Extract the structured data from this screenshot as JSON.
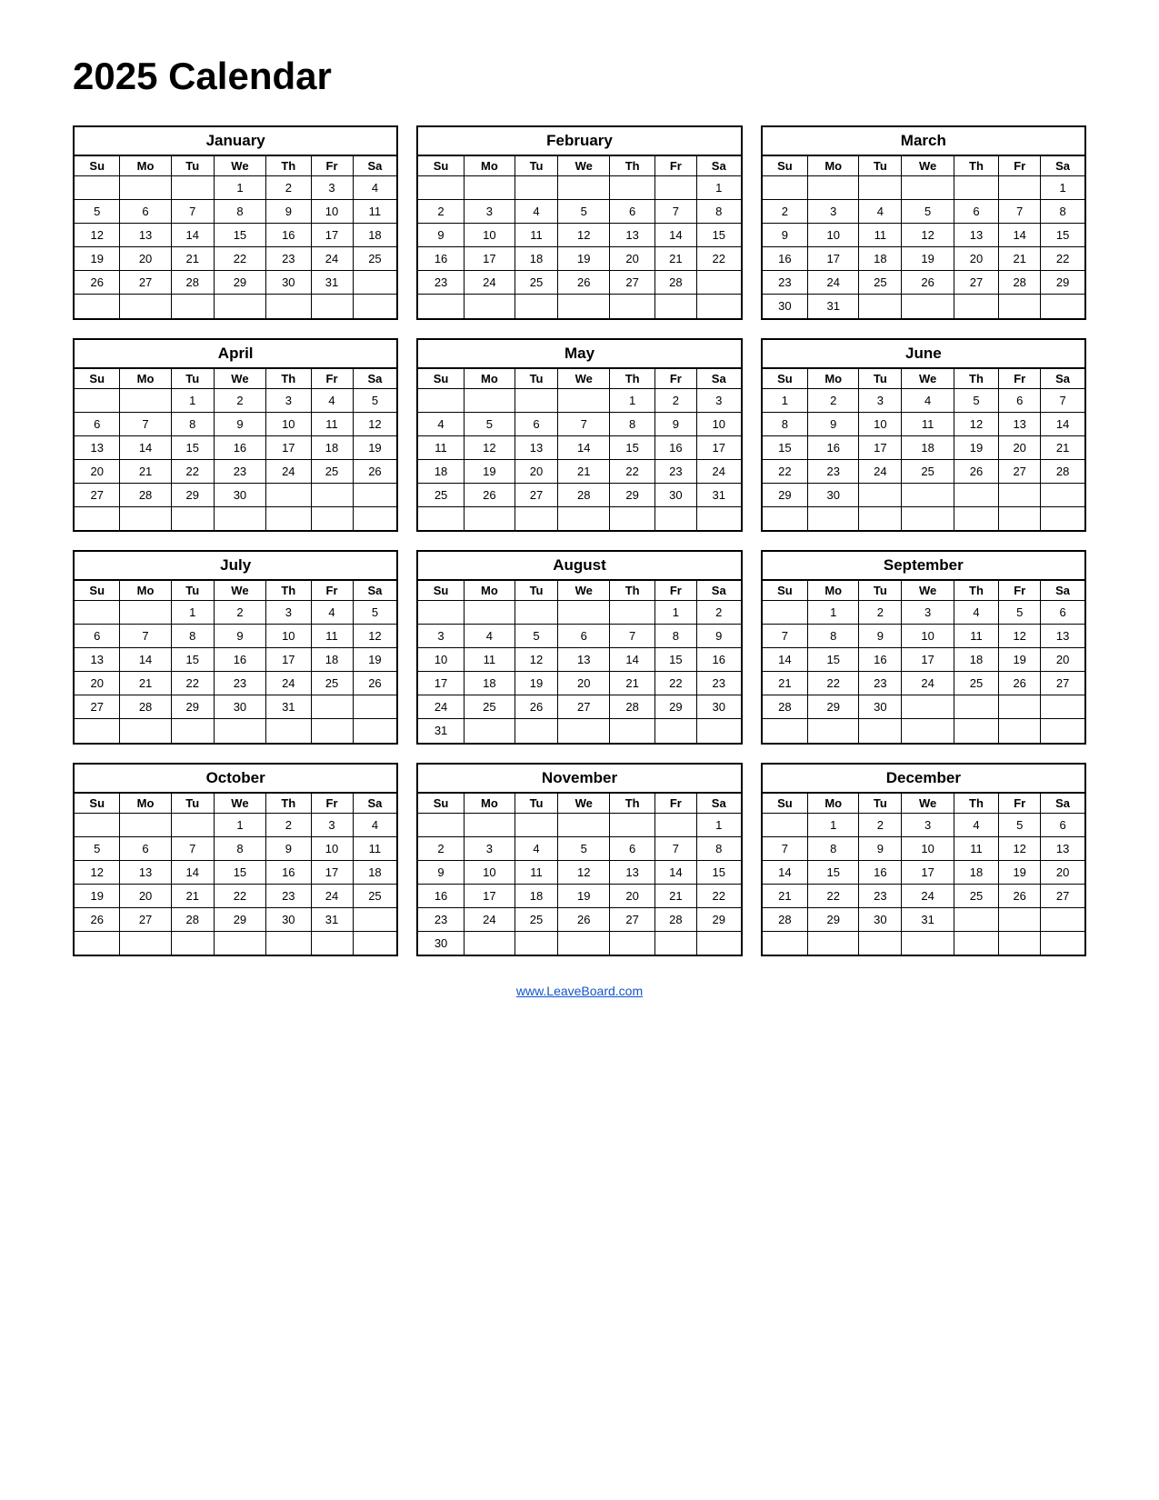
{
  "title": "2025 Calendar",
  "footer_link": "www.LeaveBoard.com",
  "months": [
    {
      "name": "January",
      "days": [
        "Su",
        "Mo",
        "Tu",
        "We",
        "Th",
        "Fr",
        "Sa"
      ],
      "weeks": [
        [
          "",
          "",
          "",
          "1",
          "2",
          "3",
          "4"
        ],
        [
          "5",
          "6",
          "7",
          "8",
          "9",
          "10",
          "11"
        ],
        [
          "12",
          "13",
          "14",
          "15",
          "16",
          "17",
          "18"
        ],
        [
          "19",
          "20",
          "21",
          "22",
          "23",
          "24",
          "25"
        ],
        [
          "26",
          "27",
          "28",
          "29",
          "30",
          "31",
          ""
        ],
        [
          "",
          "",
          "",
          "",
          "",
          "",
          ""
        ]
      ]
    },
    {
      "name": "February",
      "days": [
        "Su",
        "Mo",
        "Tu",
        "We",
        "Th",
        "Fr",
        "Sa"
      ],
      "weeks": [
        [
          "",
          "",
          "",
          "",
          "",
          "",
          "1"
        ],
        [
          "2",
          "3",
          "4",
          "5",
          "6",
          "7",
          "8"
        ],
        [
          "9",
          "10",
          "11",
          "12",
          "13",
          "14",
          "15"
        ],
        [
          "16",
          "17",
          "18",
          "19",
          "20",
          "21",
          "22"
        ],
        [
          "23",
          "24",
          "25",
          "26",
          "27",
          "28",
          ""
        ],
        [
          "",
          "",
          "",
          "",
          "",
          "",
          ""
        ]
      ]
    },
    {
      "name": "March",
      "days": [
        "Su",
        "Mo",
        "Tu",
        "We",
        "Th",
        "Fr",
        "Sa"
      ],
      "weeks": [
        [
          "",
          "",
          "",
          "",
          "",
          "",
          "1"
        ],
        [
          "2",
          "3",
          "4",
          "5",
          "6",
          "7",
          "8"
        ],
        [
          "9",
          "10",
          "11",
          "12",
          "13",
          "14",
          "15"
        ],
        [
          "16",
          "17",
          "18",
          "19",
          "20",
          "21",
          "22"
        ],
        [
          "23",
          "24",
          "25",
          "26",
          "27",
          "28",
          "29"
        ],
        [
          "30",
          "31",
          "",
          "",
          "",
          "",
          ""
        ]
      ]
    },
    {
      "name": "April",
      "days": [
        "Su",
        "Mo",
        "Tu",
        "We",
        "Th",
        "Fr",
        "Sa"
      ],
      "weeks": [
        [
          "",
          "",
          "1",
          "2",
          "3",
          "4",
          "5"
        ],
        [
          "6",
          "7",
          "8",
          "9",
          "10",
          "11",
          "12"
        ],
        [
          "13",
          "14",
          "15",
          "16",
          "17",
          "18",
          "19"
        ],
        [
          "20",
          "21",
          "22",
          "23",
          "24",
          "25",
          "26"
        ],
        [
          "27",
          "28",
          "29",
          "30",
          "",
          "",
          ""
        ],
        [
          "",
          "",
          "",
          "",
          "",
          "",
          ""
        ]
      ]
    },
    {
      "name": "May",
      "days": [
        "Su",
        "Mo",
        "Tu",
        "We",
        "Th",
        "Fr",
        "Sa"
      ],
      "weeks": [
        [
          "",
          "",
          "",
          "",
          "1",
          "2",
          "3"
        ],
        [
          "4",
          "5",
          "6",
          "7",
          "8",
          "9",
          "10"
        ],
        [
          "11",
          "12",
          "13",
          "14",
          "15",
          "16",
          "17"
        ],
        [
          "18",
          "19",
          "20",
          "21",
          "22",
          "23",
          "24"
        ],
        [
          "25",
          "26",
          "27",
          "28",
          "29",
          "30",
          "31"
        ],
        [
          "",
          "",
          "",
          "",
          "",
          "",
          ""
        ]
      ]
    },
    {
      "name": "June",
      "days": [
        "Su",
        "Mo",
        "Tu",
        "We",
        "Th",
        "Fr",
        "Sa"
      ],
      "weeks": [
        [
          "1",
          "2",
          "3",
          "4",
          "5",
          "6",
          "7"
        ],
        [
          "8",
          "9",
          "10",
          "11",
          "12",
          "13",
          "14"
        ],
        [
          "15",
          "16",
          "17",
          "18",
          "19",
          "20",
          "21"
        ],
        [
          "22",
          "23",
          "24",
          "25",
          "26",
          "27",
          "28"
        ],
        [
          "29",
          "30",
          "",
          "",
          "",
          "",
          ""
        ],
        [
          "",
          "",
          "",
          "",
          "",
          "",
          ""
        ]
      ]
    },
    {
      "name": "July",
      "days": [
        "Su",
        "Mo",
        "Tu",
        "We",
        "Th",
        "Fr",
        "Sa"
      ],
      "weeks": [
        [
          "",
          "",
          "1",
          "2",
          "3",
          "4",
          "5"
        ],
        [
          "6",
          "7",
          "8",
          "9",
          "10",
          "11",
          "12"
        ],
        [
          "13",
          "14",
          "15",
          "16",
          "17",
          "18",
          "19"
        ],
        [
          "20",
          "21",
          "22",
          "23",
          "24",
          "25",
          "26"
        ],
        [
          "27",
          "28",
          "29",
          "30",
          "31",
          "",
          ""
        ],
        [
          "",
          "",
          "",
          "",
          "",
          "",
          ""
        ]
      ]
    },
    {
      "name": "August",
      "days": [
        "Su",
        "Mo",
        "Tu",
        "We",
        "Th",
        "Fr",
        "Sa"
      ],
      "weeks": [
        [
          "",
          "",
          "",
          "",
          "",
          "1",
          "2"
        ],
        [
          "3",
          "4",
          "5",
          "6",
          "7",
          "8",
          "9"
        ],
        [
          "10",
          "11",
          "12",
          "13",
          "14",
          "15",
          "16"
        ],
        [
          "17",
          "18",
          "19",
          "20",
          "21",
          "22",
          "23"
        ],
        [
          "24",
          "25",
          "26",
          "27",
          "28",
          "29",
          "30"
        ],
        [
          "31",
          "",
          "",
          "",
          "",
          "",
          ""
        ]
      ]
    },
    {
      "name": "September",
      "days": [
        "Su",
        "Mo",
        "Tu",
        "We",
        "Th",
        "Fr",
        "Sa"
      ],
      "weeks": [
        [
          "",
          "1",
          "2",
          "3",
          "4",
          "5",
          "6"
        ],
        [
          "7",
          "8",
          "9",
          "10",
          "11",
          "12",
          "13"
        ],
        [
          "14",
          "15",
          "16",
          "17",
          "18",
          "19",
          "20"
        ],
        [
          "21",
          "22",
          "23",
          "24",
          "25",
          "26",
          "27"
        ],
        [
          "28",
          "29",
          "30",
          "",
          "",
          "",
          ""
        ],
        [
          "",
          "",
          "",
          "",
          "",
          "",
          ""
        ]
      ]
    },
    {
      "name": "October",
      "days": [
        "Su",
        "Mo",
        "Tu",
        "We",
        "Th",
        "Fr",
        "Sa"
      ],
      "weeks": [
        [
          "",
          "",
          "",
          "1",
          "2",
          "3",
          "4"
        ],
        [
          "5",
          "6",
          "7",
          "8",
          "9",
          "10",
          "11"
        ],
        [
          "12",
          "13",
          "14",
          "15",
          "16",
          "17",
          "18"
        ],
        [
          "19",
          "20",
          "21",
          "22",
          "23",
          "24",
          "25"
        ],
        [
          "26",
          "27",
          "28",
          "29",
          "30",
          "31",
          ""
        ],
        [
          "",
          "",
          "",
          "",
          "",
          "",
          ""
        ]
      ]
    },
    {
      "name": "November",
      "days": [
        "Su",
        "Mo",
        "Tu",
        "We",
        "Th",
        "Fr",
        "Sa"
      ],
      "weeks": [
        [
          "",
          "",
          "",
          "",
          "",
          "",
          "1"
        ],
        [
          "2",
          "3",
          "4",
          "5",
          "6",
          "7",
          "8"
        ],
        [
          "9",
          "10",
          "11",
          "12",
          "13",
          "14",
          "15"
        ],
        [
          "16",
          "17",
          "18",
          "19",
          "20",
          "21",
          "22"
        ],
        [
          "23",
          "24",
          "25",
          "26",
          "27",
          "28",
          "29"
        ],
        [
          "30",
          "",
          "",
          "",
          "",
          "",
          ""
        ]
      ]
    },
    {
      "name": "December",
      "days": [
        "Su",
        "Mo",
        "Tu",
        "We",
        "Th",
        "Fr",
        "Sa"
      ],
      "weeks": [
        [
          "",
          "1",
          "2",
          "3",
          "4",
          "5",
          "6"
        ],
        [
          "7",
          "8",
          "9",
          "10",
          "11",
          "12",
          "13"
        ],
        [
          "14",
          "15",
          "16",
          "17",
          "18",
          "19",
          "20"
        ],
        [
          "21",
          "22",
          "23",
          "24",
          "25",
          "26",
          "27"
        ],
        [
          "28",
          "29",
          "30",
          "31",
          "",
          "",
          ""
        ],
        [
          "",
          "",
          "",
          "",
          "",
          "",
          ""
        ]
      ]
    }
  ]
}
